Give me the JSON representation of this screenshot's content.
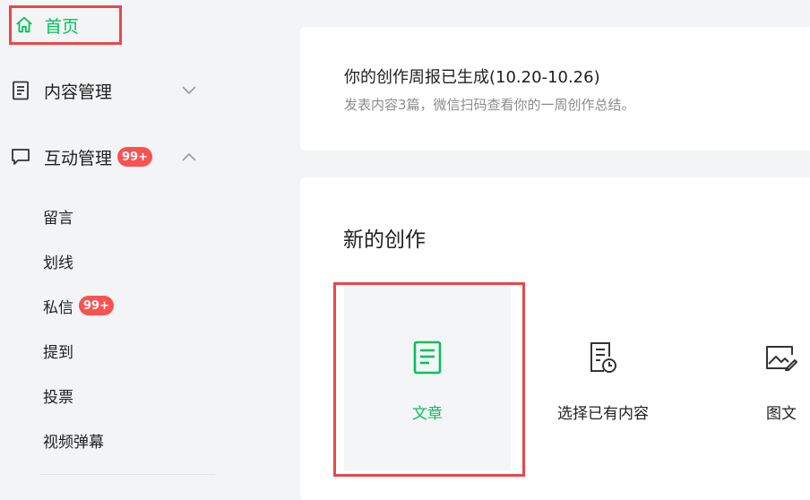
{
  "sidebar": {
    "home": {
      "label": "首页"
    },
    "content_mgmt": {
      "label": "内容管理"
    },
    "interaction_mgmt": {
      "label": "互动管理",
      "badge": "99+"
    },
    "sub_items": [
      {
        "label": "留言"
      },
      {
        "label": "划线"
      },
      {
        "label": "私信",
        "badge": "99+"
      },
      {
        "label": "提到"
      },
      {
        "label": "投票"
      },
      {
        "label": "视频弹幕"
      }
    ]
  },
  "weekly_report": {
    "title": "你的创作周报已生成(10.20-10.26)",
    "description": "发表内容3篇，微信扫码查看你的一周创作总结。"
  },
  "new_creation": {
    "heading": "新的创作",
    "options": [
      {
        "label": "文章",
        "icon": "document-icon"
      },
      {
        "label": "选择已有内容",
        "icon": "document-clock-icon"
      },
      {
        "label": "图文",
        "icon": "image-icon"
      }
    ]
  },
  "colors": {
    "accent": "#07c160",
    "badge": "#fa5151",
    "highlight": "#e9474a"
  }
}
